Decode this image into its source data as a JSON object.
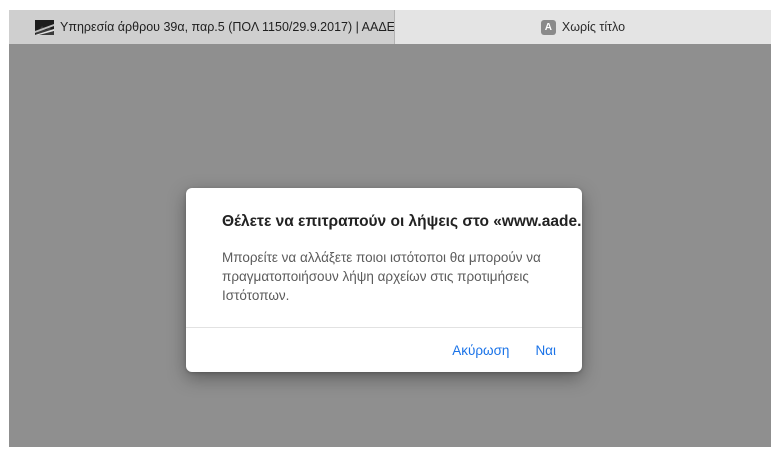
{
  "tabs": [
    {
      "title": "Υπηρεσία άρθρου 39α, παρ.5 (ΠΟΛ 1150/29.9.2017) | ΑΑΔΕ",
      "icon": "aade-favicon-icon",
      "active": true
    },
    {
      "title": "Χωρίς τίτλο",
      "icon": "letter-a-favicon-icon",
      "icon_letter": "A",
      "active": false
    }
  ],
  "dialog": {
    "title": "Θέλετε να επιτραπούν οι λήψεις στο «www.aade.gr»;",
    "message": "Μπορείτε να αλλάξετε ποιοι ιστότοποι θα μπορούν να πραγματοποιήσουν λήψη αρχείων στις προτιμήσεις Ιστότοπων.",
    "cancel_label": "Ακύρωση",
    "confirm_label": "Ναι"
  },
  "colors": {
    "overlay": "#8f8f8f",
    "active_tab": "#cfcfcf",
    "inactive_tab": "#e4e4e4",
    "accent": "#1a73e8"
  }
}
